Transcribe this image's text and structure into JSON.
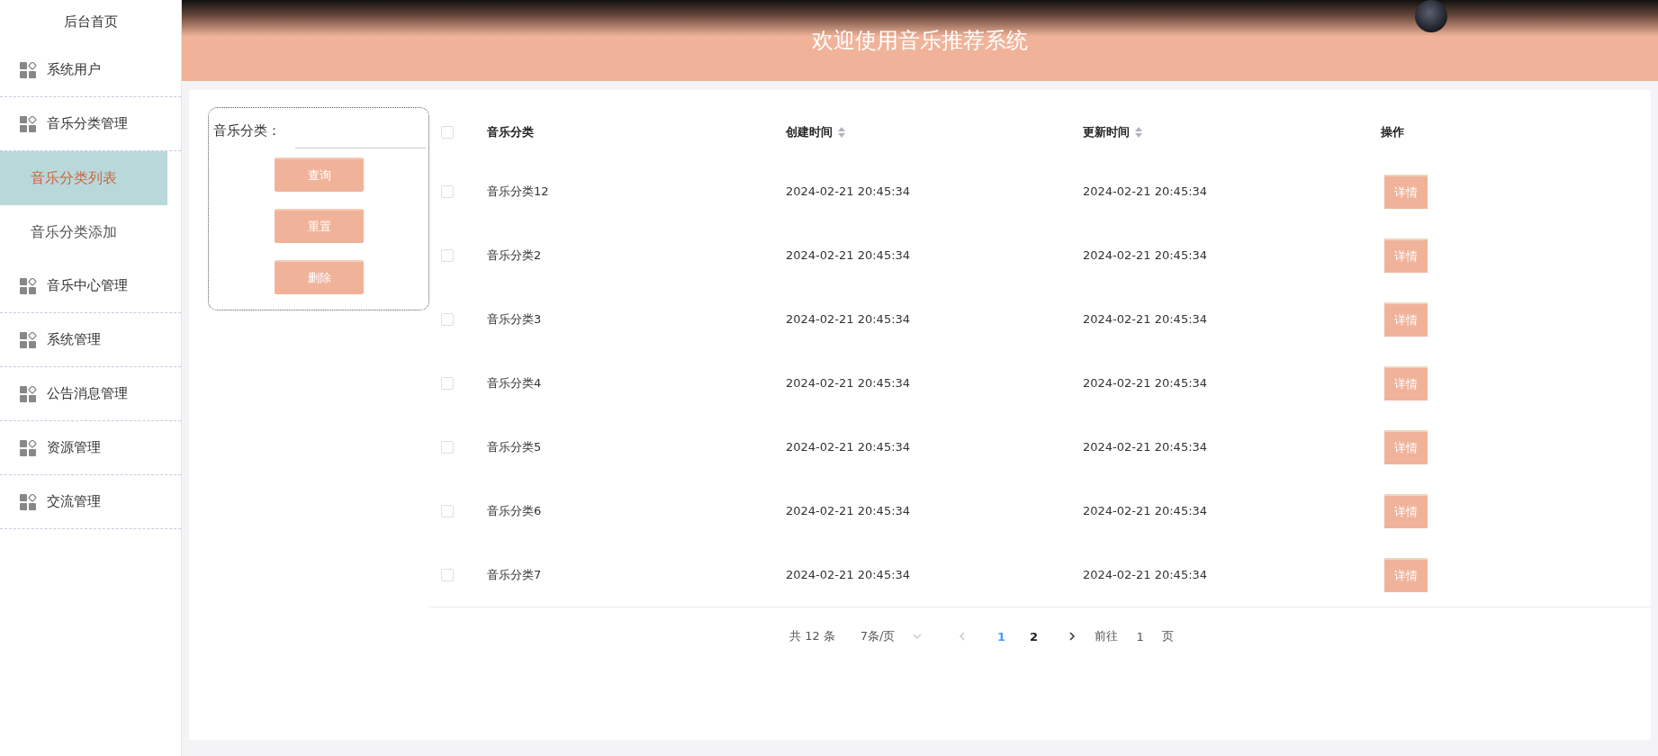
{
  "sidebar": {
    "items": [
      {
        "label": "后台首页",
        "kind": "plain"
      },
      {
        "label": "系统用户",
        "kind": "group"
      },
      {
        "label": "音乐分类管理",
        "kind": "group",
        "children": [
          {
            "label": "音乐分类列表",
            "selected": true
          },
          {
            "label": "音乐分类添加",
            "selected": false
          }
        ]
      },
      {
        "label": "音乐中心管理",
        "kind": "group"
      },
      {
        "label": "系统管理",
        "kind": "group"
      },
      {
        "label": "公告消息管理",
        "kind": "group"
      },
      {
        "label": "资源管理",
        "kind": "group"
      },
      {
        "label": "交流管理",
        "kind": "group"
      }
    ]
  },
  "header": {
    "title": "欢迎使用音乐推荐系统"
  },
  "search": {
    "label": "音乐分类：",
    "buttons": [
      "查询",
      "重置",
      "删除"
    ]
  },
  "table": {
    "header_checked": false,
    "columns": [
      {
        "label": "音乐分类",
        "sortable": false
      },
      {
        "label": "创建时间",
        "sortable": true
      },
      {
        "label": "更新时间",
        "sortable": true
      },
      {
        "label": "操作",
        "sortable": false
      }
    ],
    "rows": [
      {
        "checked": false,
        "cells": [
          "音乐分类12",
          "2024-02-21 20:45:34",
          "2024-02-21 20:45:34"
        ],
        "action": "详情"
      },
      {
        "checked": false,
        "cells": [
          "音乐分类2",
          "2024-02-21 20:45:34",
          "2024-02-21 20:45:34"
        ],
        "action": "详情"
      },
      {
        "checked": false,
        "cells": [
          "音乐分类3",
          "2024-02-21 20:45:34",
          "2024-02-21 20:45:34"
        ],
        "action": "详情"
      },
      {
        "checked": false,
        "cells": [
          "音乐分类4",
          "2024-02-21 20:45:34",
          "2024-02-21 20:45:34"
        ],
        "action": "详情"
      },
      {
        "checked": false,
        "cells": [
          "音乐分类5",
          "2024-02-21 20:45:34",
          "2024-02-21 20:45:34"
        ],
        "action": "详情"
      },
      {
        "checked": false,
        "cells": [
          "音乐分类6",
          "2024-02-21 20:45:34",
          "2024-02-21 20:45:34"
        ],
        "action": "详情"
      },
      {
        "checked": false,
        "cells": [
          "音乐分类7",
          "2024-02-21 20:45:34",
          "2024-02-21 20:45:34"
        ],
        "action": "详情"
      }
    ]
  },
  "pagination": {
    "total": "共 12 条",
    "page_size": "7条/页",
    "pages": [
      {
        "label": "1",
        "selected": true
      },
      {
        "label": "2",
        "selected": false
      }
    ],
    "goto_label": "前往",
    "goto_value": "1",
    "goto_suffix": "页"
  }
}
